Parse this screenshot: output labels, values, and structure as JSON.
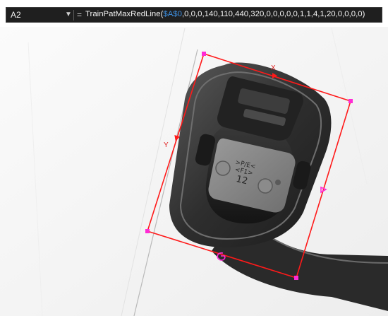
{
  "formula_bar": {
    "cell_ref": "A2",
    "equals": "=",
    "function_name": "TrainPatMaxRedLine(",
    "cell_argument": "$A$0",
    "arguments_tail": ",0,0,0,140,110,440,320,0,0,0,0,0,1,1,4,1,20,0,0,0,0)"
  },
  "image": {
    "part_mark_line1": ">P/E<",
    "part_mark_line2": "<F1>",
    "part_mark_line3": "12",
    "roi_x_label": "X",
    "roi_y_label": "Y",
    "roi_color": "#ff1a1a",
    "handle_color": "#ff2bd6"
  }
}
